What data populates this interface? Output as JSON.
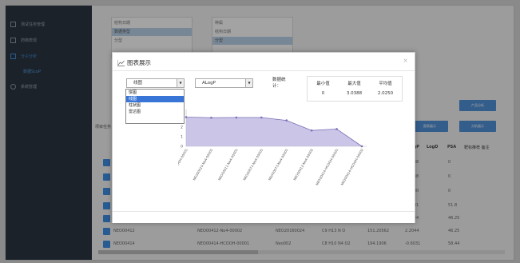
{
  "sidebar": {
    "items": [
      {
        "label": "测试任务管理",
        "icon": "monitor-icon"
      },
      {
        "label": "药物表现",
        "icon": "edit-icon"
      },
      {
        "label": "分子分析",
        "icon": "chart-icon"
      },
      {
        "label": "数据ScoP",
        "icon": ""
      },
      {
        "label": "系统管理",
        "icon": "gear-icon"
      }
    ]
  },
  "filter_panel": {
    "left_list": [
      "结构日期",
      "数据类型",
      "分型"
    ],
    "right_list": [
      "种属",
      "结构日期",
      "分型"
    ]
  },
  "toolbar": {
    "btn_right_top": "产品分析",
    "btn_chart": "图表展示",
    "btn_export": "分析展示",
    "task_label": "项目任务"
  },
  "table": {
    "headers": [
      "LogP",
      "LogD",
      "PSA",
      "靶标推荐 备注"
    ],
    "rows": [
      {
        "name": "",
        "id": "",
        "code": "",
        "formula": "",
        "mw": "",
        "logp": "...88",
        "psa": "0"
      },
      {
        "name": "",
        "id": "",
        "code": "",
        "formula": "",
        "mw": "",
        "logp": "...88",
        "psa": "0"
      },
      {
        "name": "",
        "id": "",
        "code": "",
        "formula": "",
        "mw": "",
        "logp": "...80",
        "psa": "0"
      },
      {
        "name": "",
        "id": "",
        "code": "",
        "formula": "",
        "mw": "",
        "logp": "...01",
        "psa": "51.8"
      },
      {
        "name": "",
        "id": "",
        "code": "",
        "formula": "",
        "mw": "",
        "logp": "...44",
        "psa": "46.25"
      },
      {
        "name": "NEO00412",
        "id": "NEO00412-No4-00002",
        "code": "NEO20160024",
        "formula": "C9 H13 N O",
        "mw": "151.20562",
        "logp": "2.2044",
        "psa": "46.25"
      },
      {
        "name": "NEO00414",
        "id": "NEO00414-HCOOH-00001",
        "code": "Neo002",
        "formula": "C8 H10 N4 O2",
        "mw": "194.1906",
        "logp": "-0.6031",
        "psa": "58.44"
      }
    ]
  },
  "modal": {
    "title": "图表展示",
    "chart_type_select": "线图",
    "chart_type_options": [
      "饼图",
      "线图",
      "柱状图",
      "雷达图"
    ],
    "property_select": "ALogP",
    "stats_label_1": "数据统",
    "stats_label_2": "计：",
    "stats_headers": [
      "最小值",
      "最大值",
      "平均值"
    ],
    "stats_values": [
      "0",
      "3.0388",
      "2.0250"
    ]
  },
  "chart_data": {
    "type": "area",
    "categories": [
      "NEO00001-HCOOH-00001",
      "NEO00010-No4-00001",
      "NEO00011-No4-00001",
      "NEO00071-No4-00001",
      "NEO00073-No4-00001",
      "NEO00412-No4-00002",
      "NEO00414-HCOOH-00001",
      "NEO00414-HCOOH-00002"
    ],
    "values": [
      3.04,
      2.98,
      3.0,
      3.0,
      2.7,
      1.65,
      1.8,
      0
    ],
    "yticks": [
      "0",
      "1",
      "2",
      "3"
    ],
    "ylim": [
      0,
      3.5
    ],
    "fill_color": "#b9b3e0",
    "line_color": "#7a70b5"
  },
  "colors": {
    "sidebar": "#2b3541",
    "accent": "#3c8de0"
  }
}
